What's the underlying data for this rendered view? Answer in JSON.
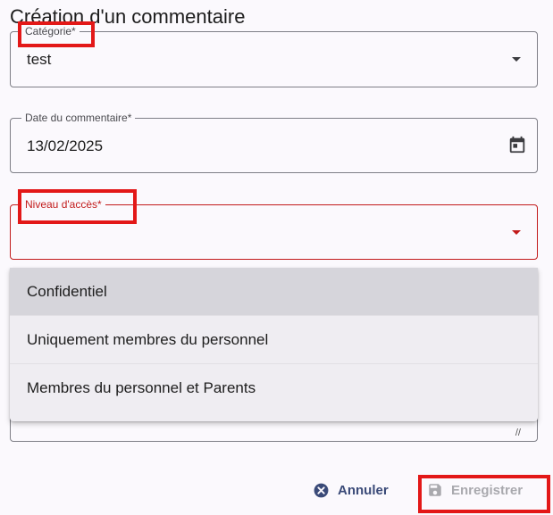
{
  "dialog": {
    "title": "Création d'un commentaire"
  },
  "fields": {
    "category": {
      "label": "Catégorie*",
      "value": "test"
    },
    "date": {
      "label": "Date du commentaire*",
      "value": "13/02/2025"
    },
    "access": {
      "label": "Niveau d'accès*",
      "value": ""
    }
  },
  "menu": {
    "items": [
      {
        "label": "Confidentiel"
      },
      {
        "label": "Uniquement membres du personnel"
      },
      {
        "label": "Membres du personnel et Parents"
      }
    ]
  },
  "actions": {
    "cancel_label": "Annuler",
    "save_label": "Enregistrer"
  },
  "icons": {
    "category_caret": "caret-down-icon",
    "date_picker": "calendar-icon",
    "access_caret": "caret-down-icon",
    "cancel": "close-circle-icon",
    "save": "floppy-disk-icon",
    "resize": "resize-handle-icon"
  },
  "colors": {
    "error": "#c21b1b",
    "primary": "#3a4a78",
    "disabled": "#a9a9ae",
    "annotation": "#e31818"
  }
}
